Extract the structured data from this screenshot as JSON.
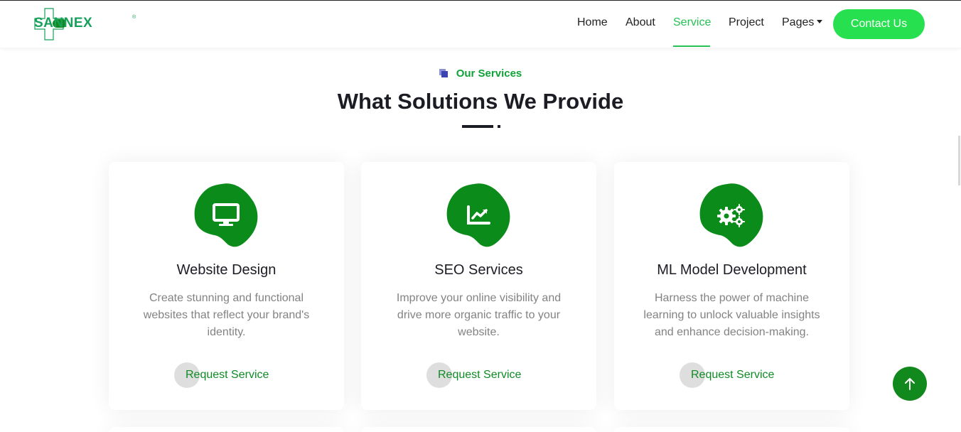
{
  "brand": {
    "name": "SANNEX",
    "reg": "®"
  },
  "nav": {
    "items": [
      {
        "label": "Home"
      },
      {
        "label": "About"
      },
      {
        "label": "Service",
        "active": true
      },
      {
        "label": "Project"
      },
      {
        "label": "Pages",
        "dropdown": true
      }
    ],
    "contact_label": "Contact Us"
  },
  "section": {
    "tag": "Our Services",
    "title": "What Solutions We Provide"
  },
  "cards": [
    {
      "icon": "monitor-icon",
      "title": "Website Design",
      "desc": "Create stunning and functional websites that reflect your brand's identity.",
      "cta": "Request Service"
    },
    {
      "icon": "chart-line-icon",
      "title": "SEO Services",
      "desc": "Improve your online visibility and drive more organic traffic to your website.",
      "cta": "Request Service"
    },
    {
      "icon": "gears-icon",
      "title": "ML Model Development",
      "desc": "Harness the power of machine learning to unlock valuable insights and enhance decision-making.",
      "cta": "Request Service"
    }
  ],
  "colors": {
    "accent": "#25c152",
    "button": "#27e04f",
    "dark_green": "#0b8b1a",
    "link_green": "#0f8b25"
  },
  "back_to_top_icon": "arrow-up-icon"
}
